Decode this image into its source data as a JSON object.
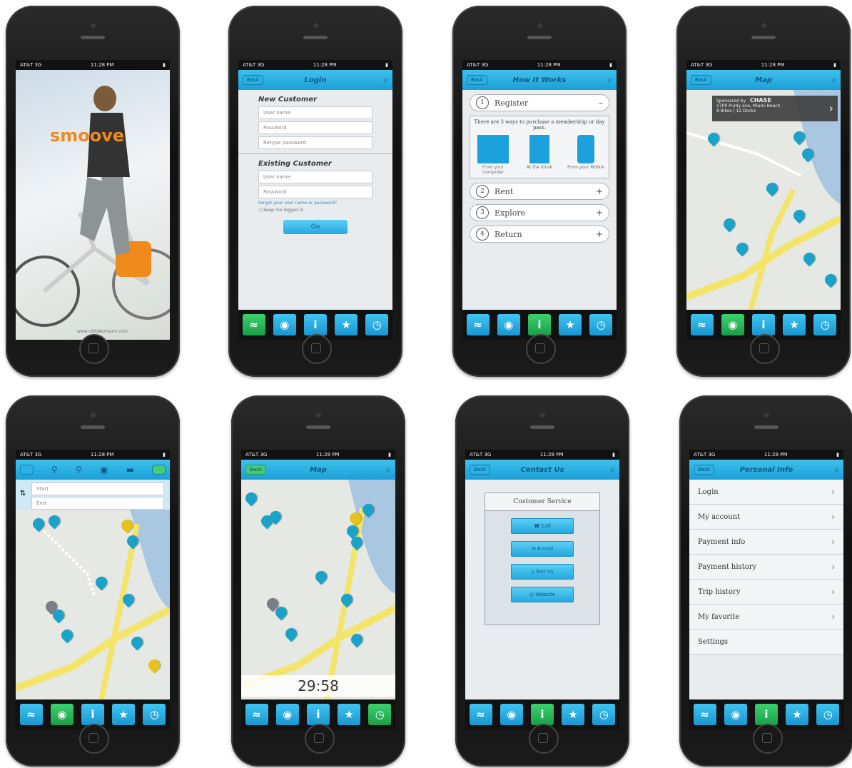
{
  "status": {
    "carrier": "AT&T 3G",
    "time": "11:28 PM"
  },
  "tabs": [
    "≈",
    "◉",
    "i",
    "★",
    "◷"
  ],
  "p1": {
    "brand": "smoove",
    "url": "www.citibikemiami.com"
  },
  "p2": {
    "left_btn": "Back",
    "title": "Login",
    "new_customer": "New Customer",
    "new_fields": [
      "User name",
      "Password",
      "Retype password"
    ],
    "existing_customer": "Existing Customer",
    "existing_fields": [
      "User name",
      "Password"
    ],
    "forgot": "Forgot your user name or password?",
    "keep": "Keep me logged in",
    "go": "Go"
  },
  "p3": {
    "left_btn": "Back",
    "title": "How It Works",
    "steps": [
      {
        "num": "1",
        "label": "Register",
        "sign": "–"
      },
      {
        "num": "2",
        "label": "Rent",
        "sign": "+"
      },
      {
        "num": "3",
        "label": "Explore",
        "sign": "+"
      },
      {
        "num": "4",
        "label": "Return",
        "sign": "+"
      }
    ],
    "register_text": "There are 3 ways to purchase a membership or day pass.",
    "ways": [
      "From your Computer",
      "At the Kiosk",
      "From your Mobile"
    ]
  },
  "p4": {
    "left_btn": "Back",
    "title": "Map",
    "sponsor_label": "Sponsored by",
    "sponsor": "CHASE",
    "address": "1700 Purdy ave, Miami Beach",
    "detail": "8 Bikes | 12 Docks"
  },
  "p5": {
    "start": "Start",
    "end": "End"
  },
  "p6": {
    "left_btn": "Back",
    "title": "Map",
    "timer": "29:58"
  },
  "p7": {
    "left_btn": "Back",
    "title": "Contact Us",
    "heading": "Customer Service",
    "buttons": [
      "Call",
      "E-mail",
      "Text Us",
      "Website"
    ]
  },
  "p8": {
    "left_btn": "Back",
    "title": "Personal Info",
    "rows": [
      "Login",
      "My account",
      "Payment info",
      "Payment history",
      "Trip history",
      "My favorite",
      "Settings"
    ]
  }
}
